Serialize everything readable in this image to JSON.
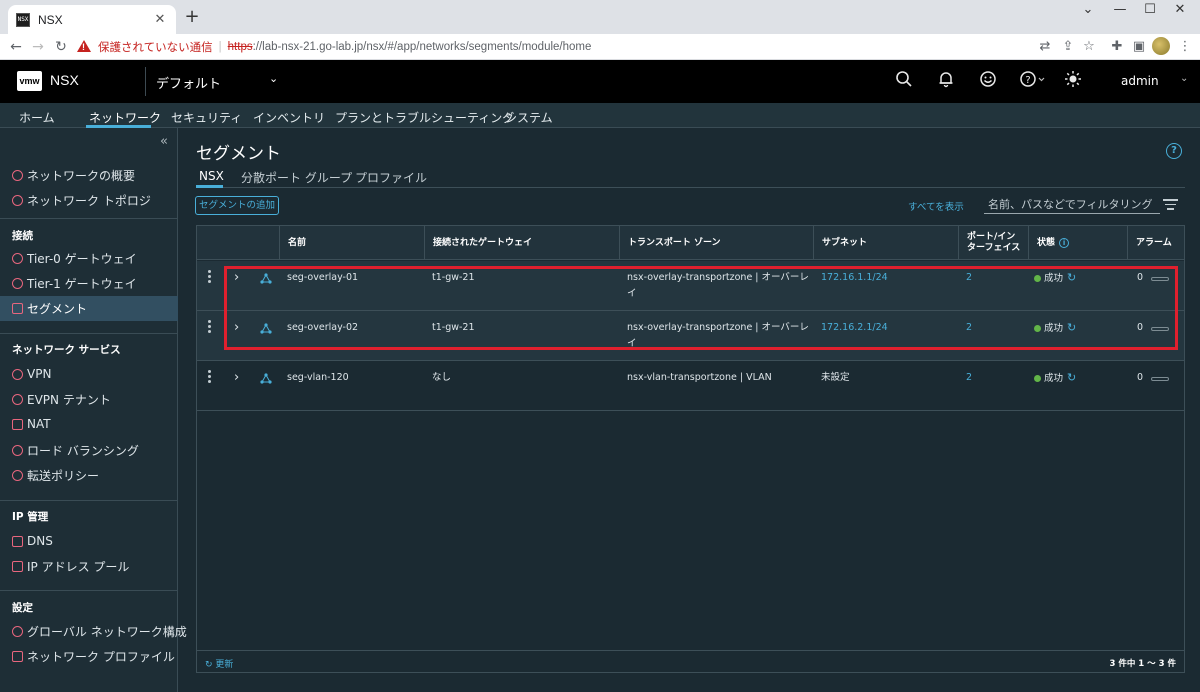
{
  "browser": {
    "tab_title": "NSX",
    "tab_close": "✕",
    "new_tab": "+",
    "insecure_label": "保護されていない通信",
    "url_scheme": "https",
    "url_rest": "://lab-nsx-21.go-lab.jp/nsx/#/app/networks/segments/module/home"
  },
  "header": {
    "product": "NSX",
    "logo": "vmw",
    "tenant": "デフォルト",
    "user": "admin",
    "icons": [
      "search-icon",
      "bell-icon",
      "smiley-icon",
      "help-icon",
      "theme-sun-icon"
    ]
  },
  "topnav": {
    "items": [
      "ホーム",
      "ネットワーク",
      "セキュリティ",
      "インベントリ",
      "プランとトラブルシューティング",
      "システム"
    ],
    "active": "ネットワーク"
  },
  "sidebar": {
    "groups": [
      {
        "items": [
          "ネットワークの概要",
          "ネットワーク トポロジ"
        ]
      },
      {
        "title": "接続",
        "items": [
          "Tier-0 ゲートウェイ",
          "Tier-1 ゲートウェイ",
          "セグメント"
        ]
      },
      {
        "title": "ネットワーク サービス",
        "items": [
          "VPN",
          "EVPN テナント",
          "NAT",
          "ロード バランシング",
          "転送ポリシー"
        ]
      },
      {
        "title": "IP 管理",
        "items": [
          "DNS",
          "IP アドレス プール"
        ]
      },
      {
        "title": "設定",
        "items": [
          "グローバル ネットワーク構成",
          "ネットワーク プロファイル"
        ]
      }
    ],
    "active": "セグメント"
  },
  "main": {
    "title": "セグメント",
    "subtabs": [
      "NSX",
      "分散ポート グループ",
      "プロファイル"
    ],
    "add_button": "セグメントの追加",
    "show_all": "すべてを表示",
    "filter_placeholder": "名前、パスなどでフィルタリング"
  },
  "grid": {
    "columns": {
      "name": "名前",
      "gateway": "接続されたゲートウェイ",
      "tz": "トランスポート ゾーン",
      "subnet": "サブネット",
      "ports_1": "ポート/イン",
      "ports_2": "ターフェイス",
      "status": "状態",
      "alarm": "アラーム"
    },
    "rows": [
      {
        "name": "seg-overlay-01",
        "gateway": "t1-gw-21",
        "tz_1": "nsx-overlay-transportzone | オーバーレ",
        "tz_2": "イ",
        "subnet": "172.16.1.1/24",
        "ports": "2",
        "status": "成功",
        "alarm": "0"
      },
      {
        "name": "seg-overlay-02",
        "gateway": "t1-gw-21",
        "tz_1": "nsx-overlay-transportzone | オーバーレ",
        "tz_2": "イ",
        "subnet": "172.16.2.1/24",
        "ports": "2",
        "status": "成功",
        "alarm": "0"
      },
      {
        "name": "seg-vlan-120",
        "gateway": "なし",
        "tz_1": "nsx-vlan-transportzone | VLAN",
        "tz_2": "",
        "subnet": "未設定",
        "ports": "2",
        "status": "成功",
        "alarm": "0"
      }
    ],
    "refresh": "更新",
    "count": "3 件中 1 ～ 3 件"
  },
  "colors": {
    "accent": "#49afd9",
    "success": "#62b548",
    "highlight": "#e0202e",
    "header_bg": "#000000",
    "content_bg": "#1b2a32"
  }
}
